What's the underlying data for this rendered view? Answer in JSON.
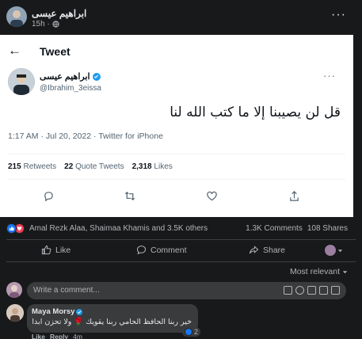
{
  "post": {
    "author": "ابراهيم عيسى",
    "meta": "15h ·",
    "more": "···"
  },
  "tweet": {
    "title": "Tweet",
    "back_icon": "arrow-left-icon",
    "author_name": "ابراهيم عيسى",
    "handle": "@Ibrahim_3eissa",
    "more": "···",
    "text": "قل لن يصيبنا إلا ما كتب الله لنا",
    "timestamp": "1:17 AM · Jul 20, 2022 · Twitter for iPhone",
    "retweets": {
      "count": "215",
      "label": "Retweets"
    },
    "quotes": {
      "count": "22",
      "label": "Quote Tweets"
    },
    "likes": {
      "count": "2,318",
      "label": "Likes"
    },
    "accent_color": "#1d9bf0"
  },
  "reactions": {
    "reactors": "Amal Rezk Alaa, Shaimaa Khamis and 3.5K others",
    "comments": "1.3K Comments",
    "shares": "108 Shares"
  },
  "actions": {
    "like": "Like",
    "comment": "Comment",
    "share": "Share"
  },
  "comments_section": {
    "filter": "Most relevant",
    "input_placeholder": "Write a comment...",
    "comment": {
      "author": "Maya Morsy",
      "text": "خير ربنا الحافظ الحامي ربنا يقويك 🌹 ولا تحزن ابدا",
      "reaction_count": "2",
      "like": "Like",
      "reply": "Reply",
      "time": "4m"
    }
  }
}
